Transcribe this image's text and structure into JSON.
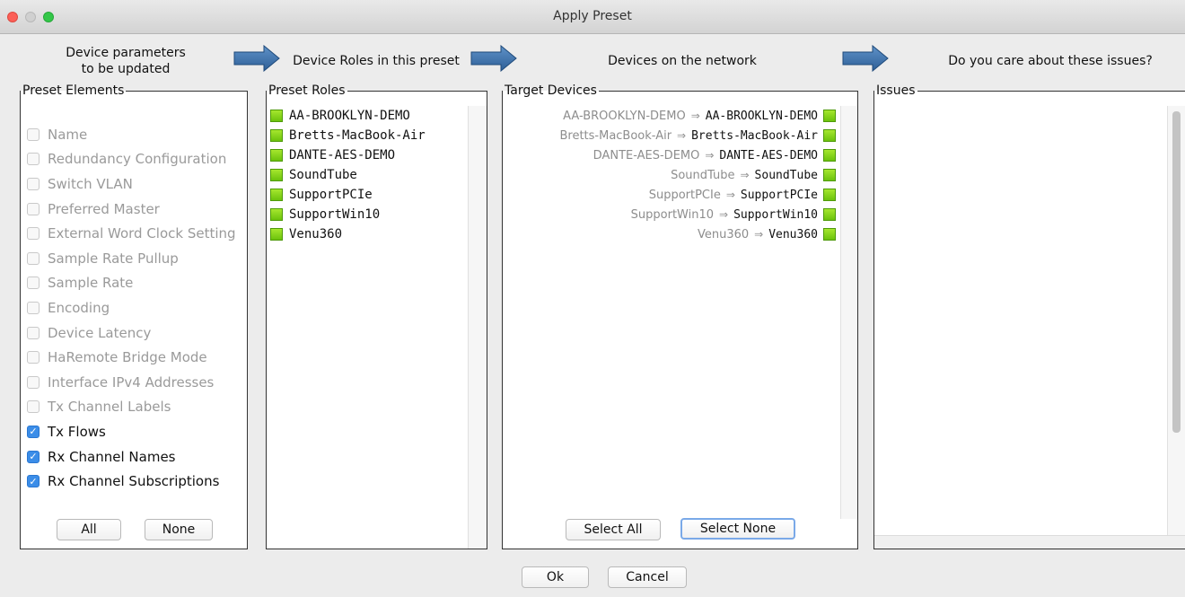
{
  "window": {
    "title": "Apply Preset"
  },
  "steps": [
    {
      "line1": "Device parameters",
      "line2": "to be updated"
    },
    {
      "label": "Device Roles in this preset"
    },
    {
      "label": "Devices on the network"
    },
    {
      "label": "Do you care about these issues?"
    }
  ],
  "preset_elements": {
    "legend": "Preset Elements",
    "items": [
      {
        "label": "Name",
        "checked": false
      },
      {
        "label": "Redundancy Configuration",
        "checked": false
      },
      {
        "label": "Switch VLAN",
        "checked": false
      },
      {
        "label": "Preferred Master",
        "checked": false
      },
      {
        "label": "External Word Clock Setting",
        "checked": false
      },
      {
        "label": "Sample Rate Pullup",
        "checked": false
      },
      {
        "label": "Sample Rate",
        "checked": false
      },
      {
        "label": "Encoding",
        "checked": false
      },
      {
        "label": "Device Latency",
        "checked": false
      },
      {
        "label": "HaRemote Bridge Mode",
        "checked": false
      },
      {
        "label": "Interface IPv4 Addresses",
        "checked": false
      },
      {
        "label": "Tx Channel Labels",
        "checked": false
      },
      {
        "label": "Tx Flows",
        "checked": true
      },
      {
        "label": "Rx Channel Names",
        "checked": true
      },
      {
        "label": "Rx Channel Subscriptions",
        "checked": true
      }
    ],
    "all_label": "All",
    "none_label": "None"
  },
  "preset_roles": {
    "legend": "Preset Roles",
    "items": [
      "AA-BROOKLYN-DEMO",
      "Bretts-MacBook-Air",
      "DANTE-AES-DEMO",
      "SoundTube",
      "SupportPCIe",
      "SupportWin10",
      "Venu360"
    ],
    "status_color": "#8fd61f"
  },
  "target_devices": {
    "legend": "Target Devices",
    "arrow_glyph": "⇒",
    "items": [
      {
        "source": "AA-BROOKLYN-DEMO",
        "target": "AA-BROOKLYN-DEMO"
      },
      {
        "source": "Bretts-MacBook-Air",
        "target": "Bretts-MacBook-Air"
      },
      {
        "source": "DANTE-AES-DEMO",
        "target": "DANTE-AES-DEMO"
      },
      {
        "source": "SoundTube",
        "target": "SoundTube"
      },
      {
        "source": "SupportPCIe",
        "target": "SupportPCIe"
      },
      {
        "source": "SupportWin10",
        "target": "SupportWin10"
      },
      {
        "source": "Venu360",
        "target": "Venu360"
      }
    ],
    "select_all_label": "Select All",
    "select_none_label": "Select None"
  },
  "issues": {
    "legend": "Issues"
  },
  "footer": {
    "ok_label": "Ok",
    "cancel_label": "Cancel"
  },
  "colors": {
    "arrow": "#3d6fa6",
    "checkbox_checked": "#3b8de8",
    "close": "#fc5f57",
    "maximize": "#33c748"
  }
}
